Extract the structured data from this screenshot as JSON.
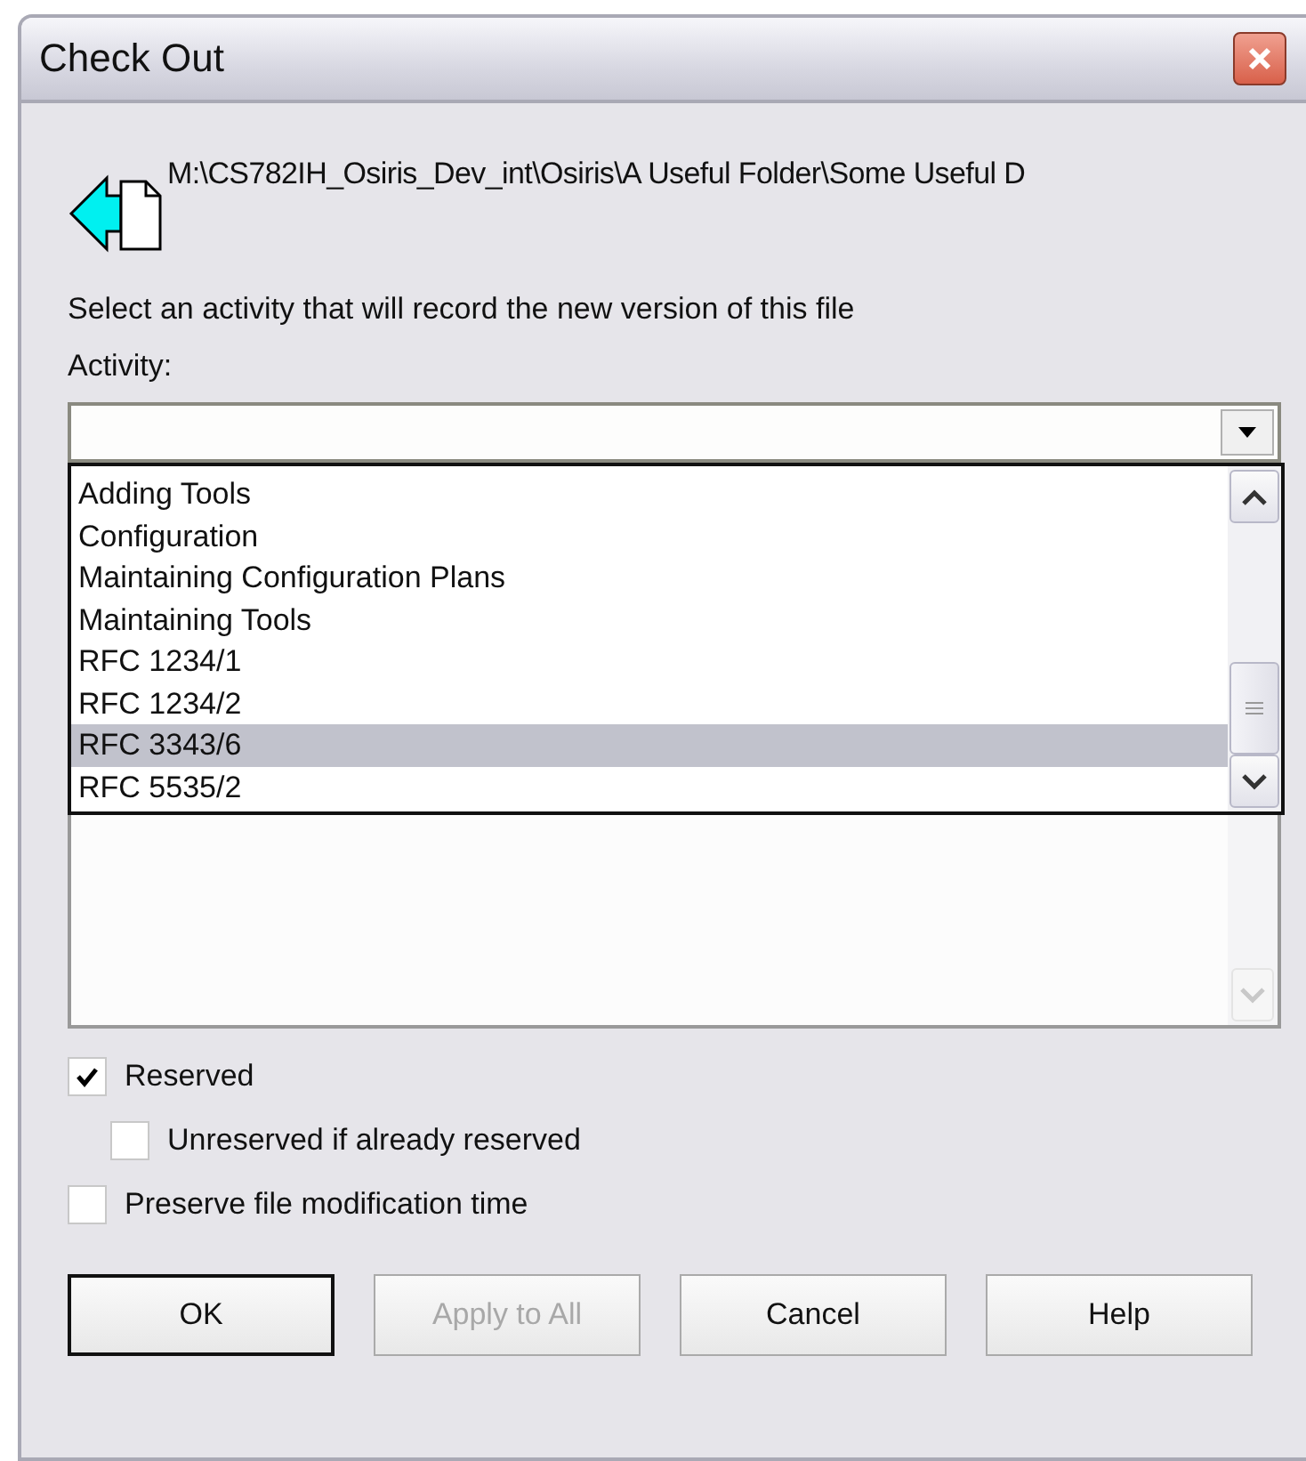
{
  "window": {
    "title": "Check Out"
  },
  "file_path": "M:\\CS782IH_Osiris_Dev_int\\Osiris\\A Useful Folder\\Some Useful D",
  "instruction": "Select an activity that will record the new version of this file",
  "activity": {
    "label": "Activity:",
    "expanded": true,
    "options": [
      {
        "label": "Adding Tools",
        "selected": false
      },
      {
        "label": "Configuration",
        "selected": false
      },
      {
        "label": "Maintaining Configuration Plans",
        "selected": false
      },
      {
        "label": "Maintaining Tools",
        "selected": false
      },
      {
        "label": "RFC 1234/1",
        "selected": false
      },
      {
        "label": "RFC 1234/2",
        "selected": false
      },
      {
        "label": "RFC 3343/6",
        "selected": true
      },
      {
        "label": "RFC 5535/2",
        "selected": false
      }
    ]
  },
  "checkboxes": [
    {
      "label": "Reserved",
      "checked": true,
      "children": [
        {
          "label": "Unreserved if already reserved",
          "checked": false
        }
      ]
    },
    {
      "label": "Preserve file modification time",
      "checked": false
    }
  ],
  "buttons": [
    {
      "label": "OK",
      "default": true,
      "disabled": false
    },
    {
      "label": "Apply to All",
      "default": false,
      "disabled": true
    },
    {
      "label": "Cancel",
      "default": false,
      "disabled": false
    },
    {
      "label": "Help",
      "default": false,
      "disabled": false
    }
  ]
}
